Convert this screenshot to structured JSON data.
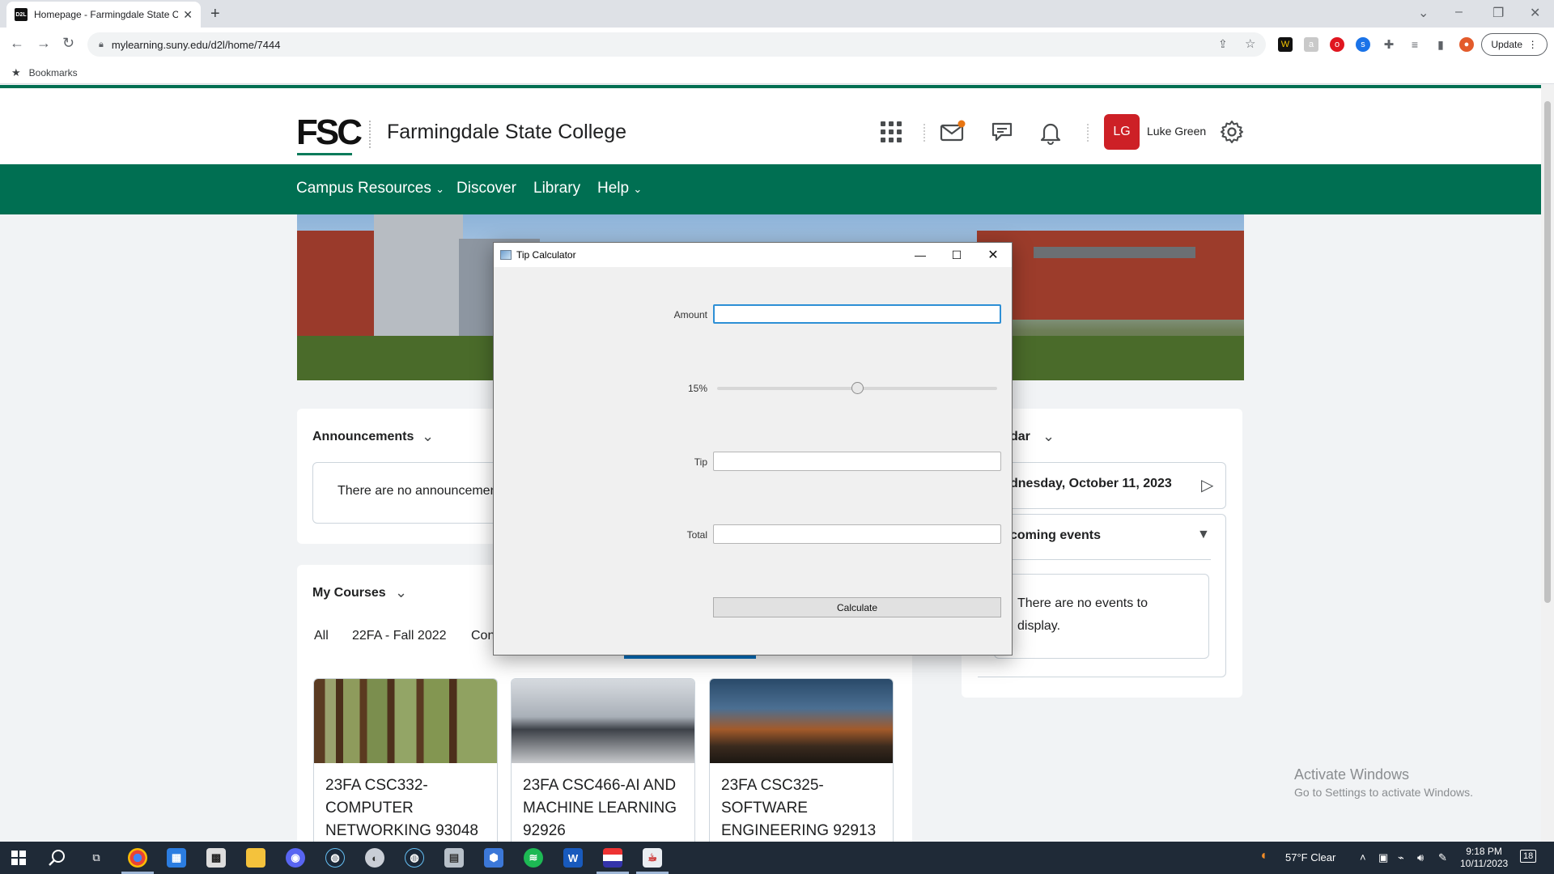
{
  "browser": {
    "tab_title": "Homepage - Farmingdale State C",
    "tab_favicon": "D2L",
    "url": "mylearning.suny.edu/d2l/home/7444",
    "bookmarks_label": "Bookmarks",
    "update_label": "Update"
  },
  "header": {
    "logo": "FSC",
    "college_name": "Farmingdale State College",
    "avatar_initials": "LG",
    "user_name": "Luke Green"
  },
  "nav": {
    "items": [
      {
        "label": "Campus Resources",
        "dropdown": true
      },
      {
        "label": "Discover",
        "dropdown": false
      },
      {
        "label": "Library",
        "dropdown": false
      },
      {
        "label": "Help",
        "dropdown": true
      }
    ]
  },
  "announcements": {
    "title": "Announcements",
    "empty_text": "There are no announcemen"
  },
  "my_courses": {
    "title": "My Courses",
    "filters": [
      "All",
      "22FA - Fall 2022",
      "Con"
    ],
    "courses": [
      {
        "name": "23FA CSC332-COMPUTER NETWORKING 93048"
      },
      {
        "name": "23FA CSC466-AI AND MACHINE LEARNING 92926"
      },
      {
        "name": "23FA CSC325-SOFTWARE ENGINEERING 92913"
      }
    ]
  },
  "calendar": {
    "title": "dar",
    "date": "dnesday, October 11, 2023",
    "upcoming_title": "coming events",
    "empty_text_1": "There are no events to",
    "empty_text_2": "display."
  },
  "watermark": {
    "line1": "Activate Windows",
    "line2": "Go to Settings to activate Windows."
  },
  "tip_calculator": {
    "window_title": "Tip Calculator",
    "amount_label": "Amount",
    "amount_value": "",
    "percent_label": "15%",
    "percent_value": 15,
    "slider_fraction": 0.5,
    "tip_label": "Tip",
    "tip_value": "",
    "total_label": "Total",
    "total_value": "",
    "calculate_label": "Calculate"
  },
  "taskbar": {
    "weather": "57°F  Clear",
    "time": "9:18 PM",
    "date": "10/11/2023",
    "notification_count": "18"
  }
}
